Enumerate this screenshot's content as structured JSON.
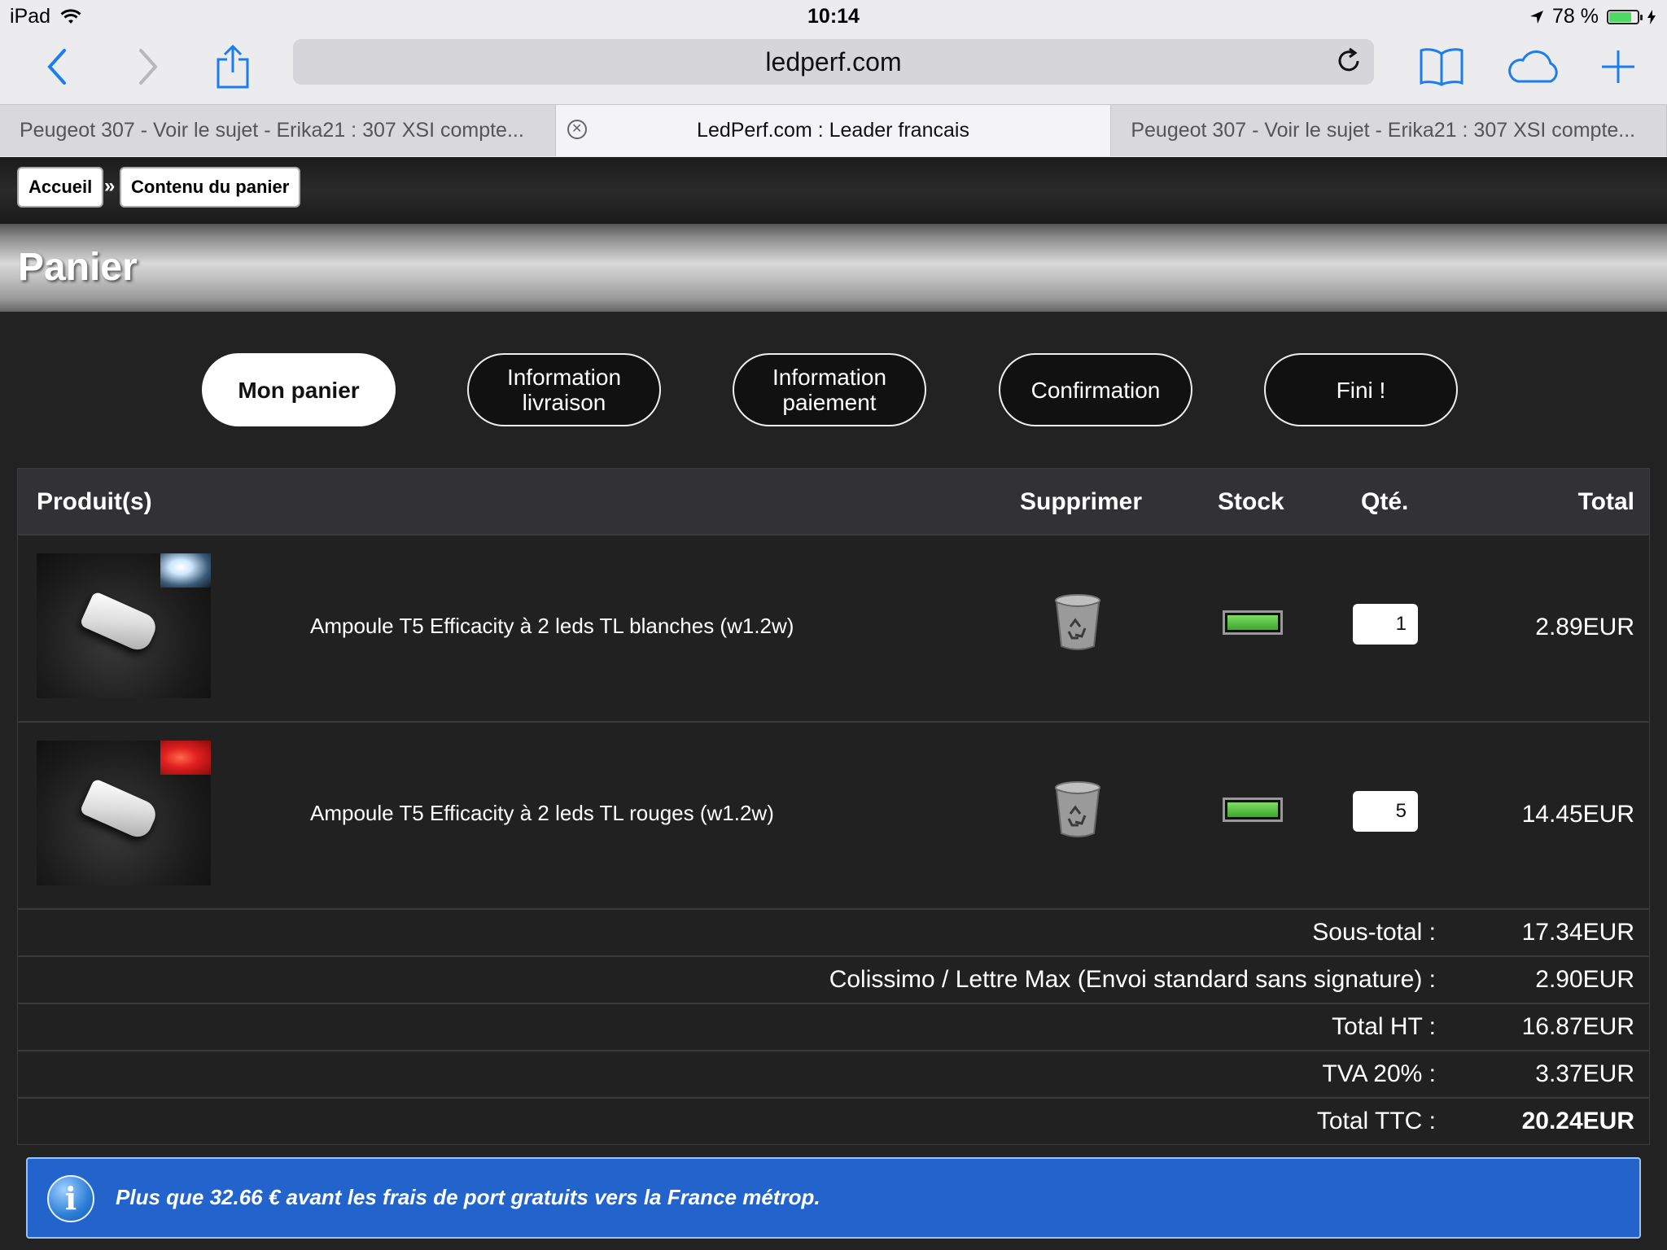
{
  "status_bar": {
    "device": "iPad",
    "time": "10:14",
    "battery": "78 %"
  },
  "browser": {
    "url": "ledperf.com",
    "tabs": [
      {
        "title": "Peugeot 307 - Voir le sujet - Erika21 : 307 XSI compte..."
      },
      {
        "title": "LedPerf.com : Leader francais"
      },
      {
        "title": "Peugeot 307 - Voir le sujet - Erika21 : 307 XSI compte..."
      }
    ]
  },
  "breadcrumb": {
    "home": "Accueil",
    "separator": "»",
    "current": "Contenu du panier"
  },
  "page_title": "Panier",
  "steps": [
    "Mon panier",
    "Information\nlivraison",
    "Information\npaiement",
    "Confirmation",
    "Fini !"
  ],
  "table": {
    "headers": {
      "product": "Produit(s)",
      "delete": "Supprimer",
      "stock": "Stock",
      "qty": "Qté.",
      "total": "Total"
    },
    "rows": [
      {
        "name": "Ampoule T5 Efficacity à  2 leds TL blanches (w1.2w)",
        "qty": "1",
        "total": "2.89EUR",
        "stock_level": 1.0
      },
      {
        "name": "Ampoule T5 Efficacity à  2 leds TL rouges (w1.2w)",
        "qty": "5",
        "total": "14.45EUR",
        "stock_level": 1.0
      }
    ]
  },
  "summary": [
    {
      "label": "Sous-total :",
      "value": "17.34EUR"
    },
    {
      "label": "Colissimo / Lettre Max (Envoi standard sans signature) :",
      "value": "2.90EUR"
    },
    {
      "label": "Total HT :",
      "value": "16.87EUR"
    },
    {
      "label": "TVA 20% :",
      "value": "3.37EUR"
    },
    {
      "label": "Total TTC :",
      "value": "20.24EUR"
    }
  ],
  "info": {
    "icon": "i",
    "text": "Plus que 32.66 € avant les frais de port gratuits vers la France métrop."
  },
  "colors": {
    "accent": "#2364cc",
    "safari_blue": "#1a7df0",
    "stock_green": "#4cbb3a",
    "red_led": "#e02020",
    "white_led": "#cfe8ff"
  }
}
